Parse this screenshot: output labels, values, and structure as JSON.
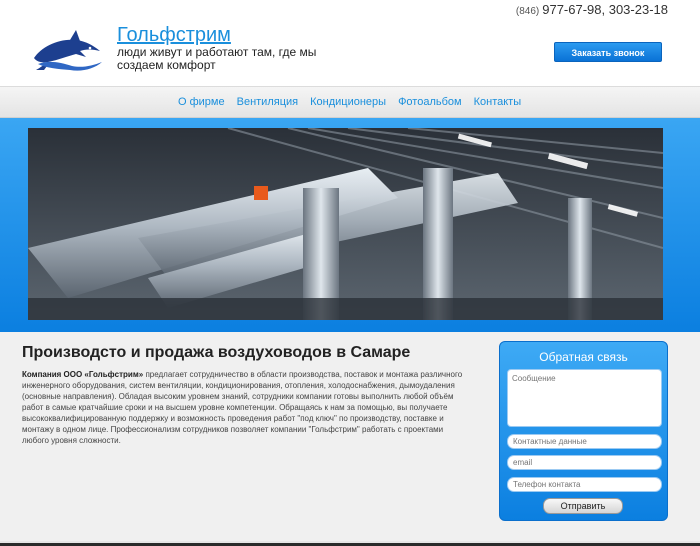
{
  "header": {
    "phone_code": "(846)",
    "phones": "977-67-98, 303-23-18",
    "brand_name": "Гольфстрим",
    "slogan": "люди живут и работают там, где мы создаем комфорт",
    "call_button": "Заказать звонок",
    "logo_icon": "dolphin-logo-icon"
  },
  "nav": {
    "items": [
      "О фирме",
      "Вентиляция",
      "Кондиционеры",
      "Фотоальбом",
      "Контакты"
    ]
  },
  "hero": {
    "image": "ventilation-ducts-photo"
  },
  "content": {
    "title": "Производсто и продажа воздуховодов в Самаре",
    "company_bold": "Компания ООО «Гольфстрим»",
    "text": "предлагает сотрудничество в области производства, поставок и монтажа различного инженерного оборудования, систем вентиляции, кондиционирования, отопления, холодоснабжения, дымоудаления (основные направления). Обладая высоким уровнем знаний, сотрудники компании готовы выполнить любой объём работ в самые кратчайшие сроки и на высшем уровне компетенции. Обращаясь к нам за помощью, вы получаете высококвалифицированную поддержку и возможность проведения работ \"под ключ\" по производству, поставке и монтажу в одном лице. Профессионализм сотрудников позволяет компании \"Гольфстрим\" работать с проектами любого уровня сложности."
  },
  "feedback": {
    "title": "Обратная связь",
    "message_placeholder": "Сообщение",
    "contact_placeholder": "Контактные данные",
    "email_placeholder": "email",
    "phone_placeholder": "Телефон контакта",
    "send_button": "Отправить"
  },
  "colors": {
    "accent": "#1a8fdc",
    "hero_blue": "#0b7fe0"
  }
}
